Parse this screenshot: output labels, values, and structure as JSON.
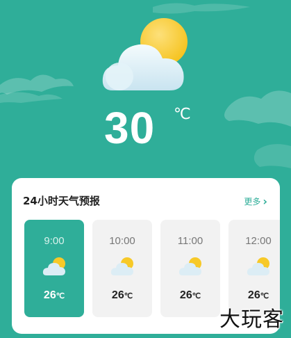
{
  "current": {
    "temperature": "30",
    "unit": "℃",
    "icon": "sun-behind-cloud-icon"
  },
  "forecast": {
    "title": "24小时天气预报",
    "more_label": "更多",
    "more_icon": "chevron-right-icon",
    "hours": [
      {
        "time": "9:00",
        "temp": "26",
        "unit": "℃",
        "icon": "partly-cloudy-icon",
        "selected": true
      },
      {
        "time": "10:00",
        "temp": "26",
        "unit": "℃",
        "icon": "partly-cloudy-icon",
        "selected": false
      },
      {
        "time": "11:00",
        "temp": "26",
        "unit": "℃",
        "icon": "partly-cloudy-icon",
        "selected": false
      },
      {
        "time": "12:00",
        "temp": "26",
        "unit": "℃",
        "icon": "partly-cloudy-icon",
        "selected": false
      }
    ]
  },
  "watermark": "大玩客",
  "colors": {
    "background": "#2fae99",
    "accent": "#2fae99",
    "card": "#ffffff",
    "hour_card": "#f2f2f2",
    "sun": "#f7c928"
  }
}
